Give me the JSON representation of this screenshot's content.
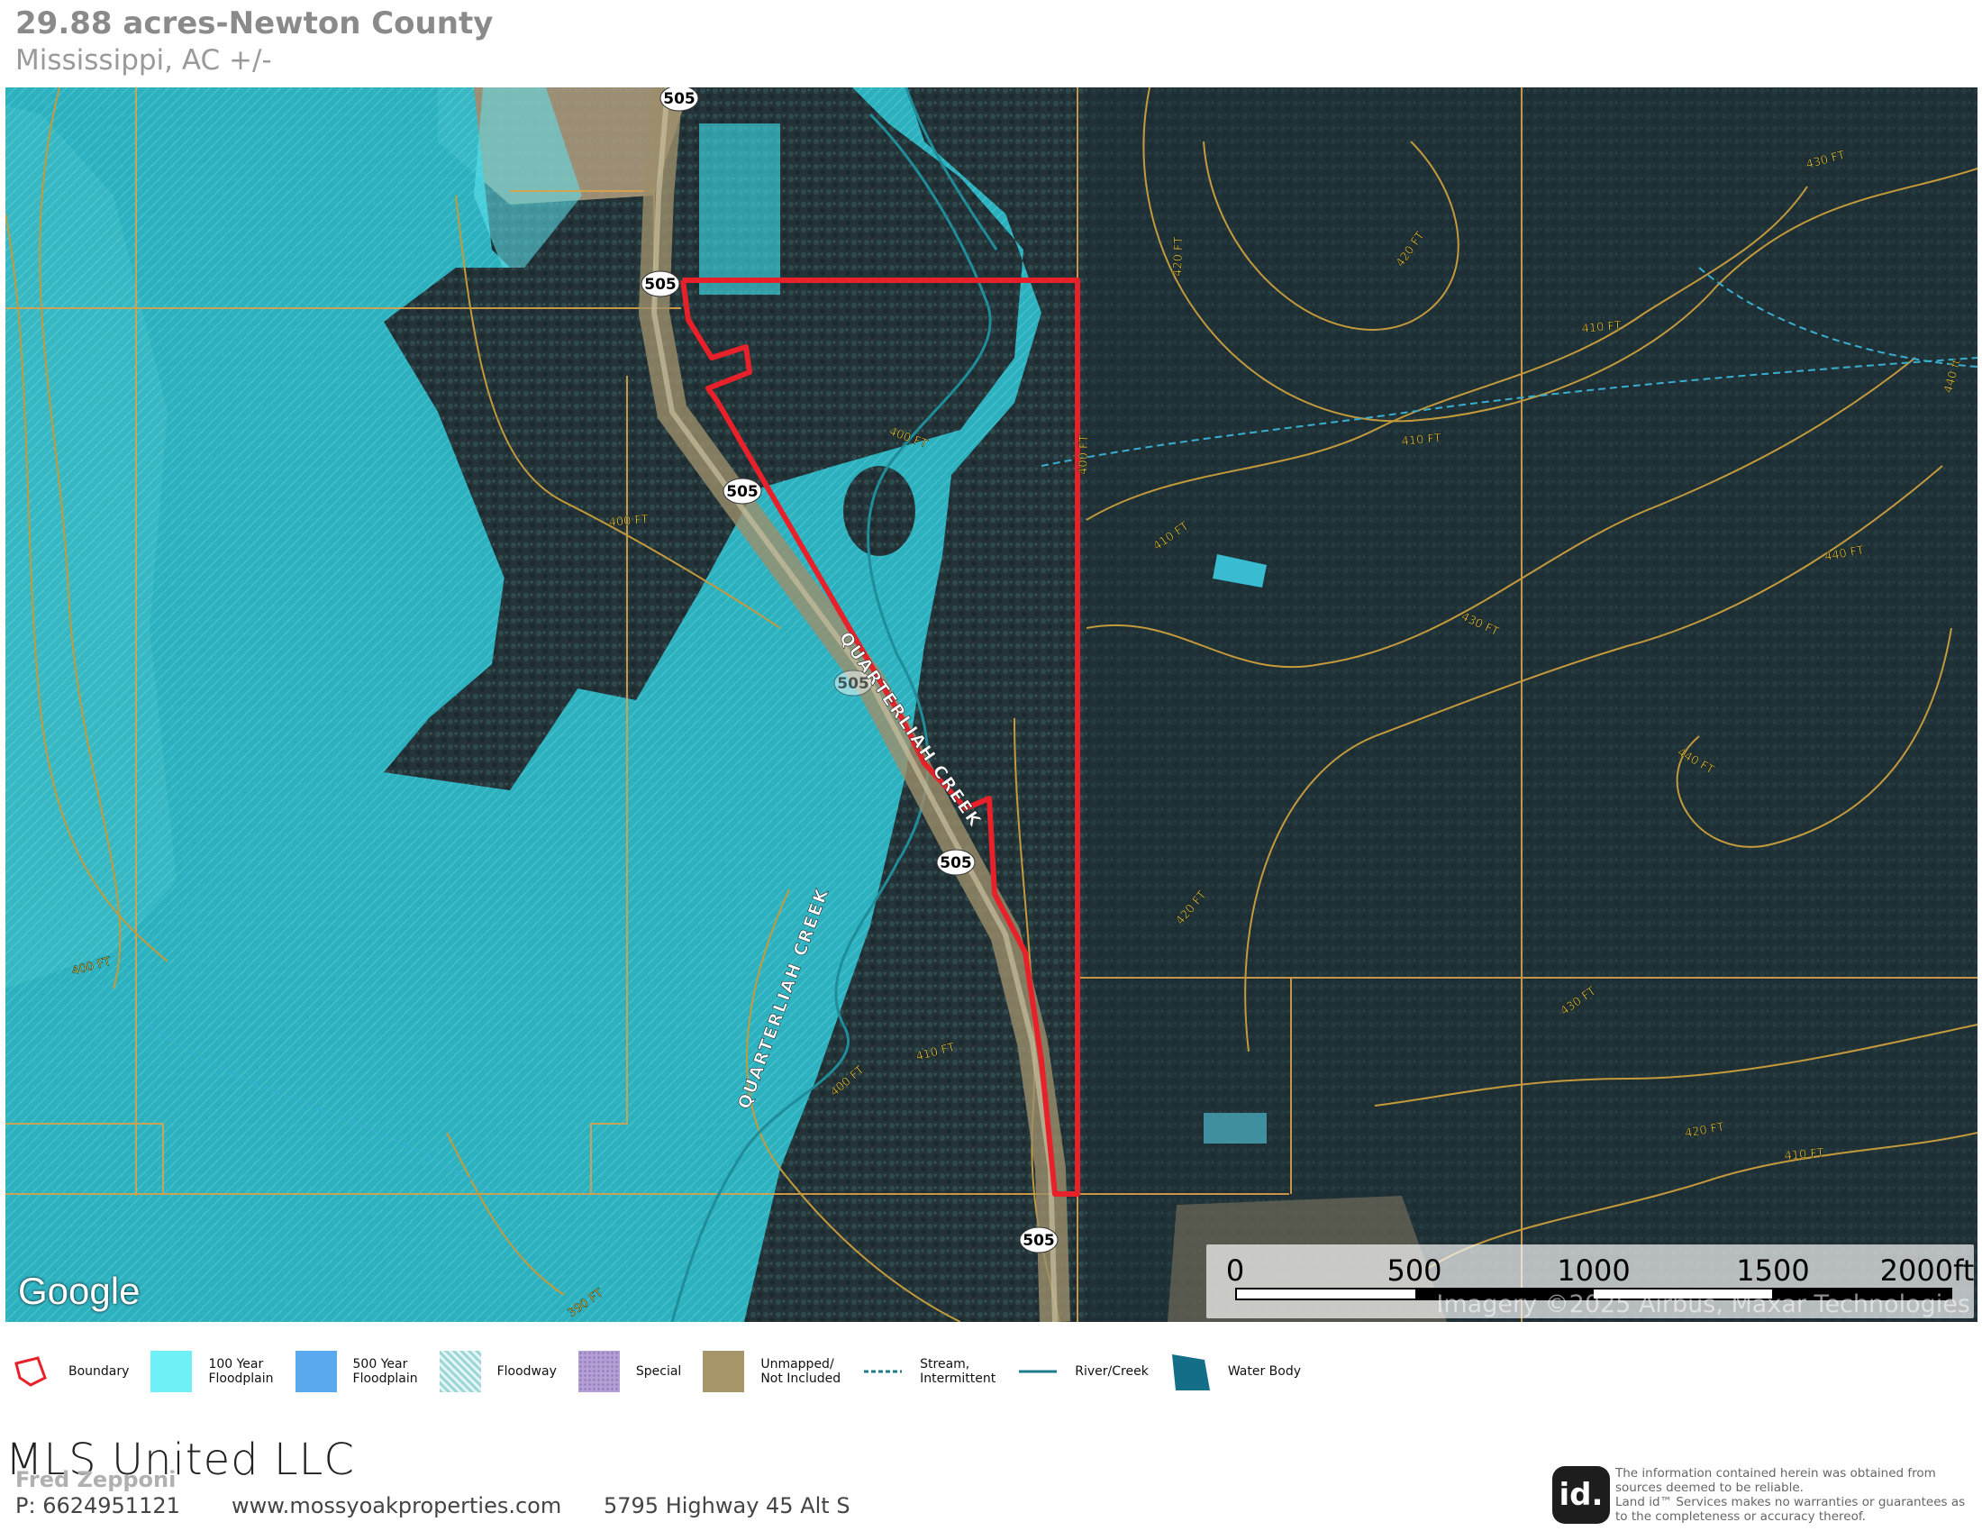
{
  "header": {
    "title": "29.88 acres-Newton County",
    "subtitle": "Mississippi,  AC +/-"
  },
  "map": {
    "route_shield": "505",
    "contour_labels": [
      "400 FT",
      "410 FT",
      "420 FT",
      "430 FT",
      "440 FT",
      "390 FT",
      "440 ft",
      "420 FT",
      "430 FT"
    ],
    "creek_label_upper": "QUARTERLIAH CREEK",
    "creek_label_lower": "QUARTERLIAH CREEK",
    "google_label": "Google",
    "imagery_credit": "Imagery ©2025 Airbus, Maxar Technologies",
    "scale": {
      "labels": [
        "0",
        "500",
        "1000",
        "1500",
        "2000ft"
      ]
    },
    "colors": {
      "floodplain_100": "#6ff0f6",
      "boundary": "#e8202a",
      "contour": "#c49a3c",
      "section_line": "#d9a24a"
    }
  },
  "legend": {
    "items": [
      {
        "icon": "boundary-icon",
        "label": "Boundary",
        "color": "#e8202a"
      },
      {
        "icon": "floodplain-100-icon",
        "label": "100 Year\nFloodplain",
        "color": "#6ff0f6"
      },
      {
        "icon": "floodplain-500-icon",
        "label": "500 Year\nFloodplain",
        "color": "#5aa9ef"
      },
      {
        "icon": "floodway-icon",
        "label": "Floodway",
        "color": "#bfe4e4"
      },
      {
        "icon": "special-icon",
        "label": "Special",
        "color": "#a68fc9"
      },
      {
        "icon": "unmapped-icon",
        "label": "Unmapped/\nNot Included",
        "color": "#a6966a"
      },
      {
        "icon": "stream-intermittent-icon",
        "label": "Stream,\nIntermittent",
        "color": "#1d7d8a"
      },
      {
        "icon": "river-creek-icon",
        "label": "River/Creek",
        "color": "#1d7d8a"
      },
      {
        "icon": "water-body-icon",
        "label": "Water Body",
        "color": "#156e87"
      }
    ]
  },
  "footer": {
    "company": "MLS United LLC",
    "agent": "Fred Zepponi",
    "phone": "P: 6624951121",
    "website": "www.mossyoakproperties.com",
    "address": "5795 Highway 45 Alt S",
    "logo_text": "id.",
    "disclaimer": "The information contained herein was obtained from sources deemed to be reliable.\n Land id™ Services makes no warranties or guarantees as to the completeness or accuracy thereof."
  }
}
